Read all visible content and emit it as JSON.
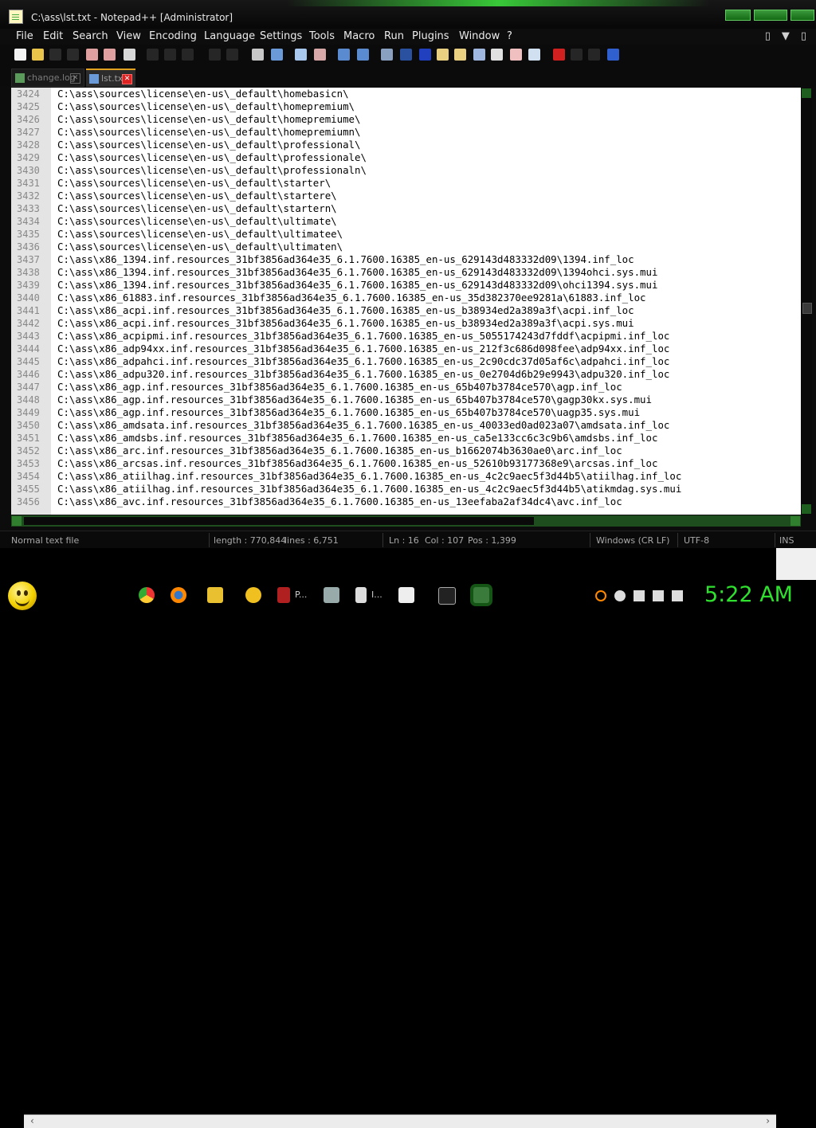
{
  "window": {
    "title": "C:\\ass\\lst.txt - Notepad++ [Administrator]"
  },
  "menu": [
    "File",
    "Edit",
    "Search",
    "View",
    "Encoding",
    "Language",
    "Settings",
    "Tools",
    "Macro",
    "Run",
    "Plugins",
    "Window",
    "?"
  ],
  "menu_right": {
    "restore_glyph": "▯",
    "dropdown_glyph": "▼",
    "close_glyph": "▯"
  },
  "tabs": [
    {
      "label": "change.log",
      "close": "✕"
    },
    {
      "label": "lst.txt",
      "close": "✕"
    }
  ],
  "editor": {
    "lines": [
      {
        "n": "3424",
        "t": "C:\\ass\\sources\\license\\en-us\\_default\\homebasicn\\"
      },
      {
        "n": "3425",
        "t": "C:\\ass\\sources\\license\\en-us\\_default\\homepremium\\"
      },
      {
        "n": "3426",
        "t": "C:\\ass\\sources\\license\\en-us\\_default\\homepremiume\\"
      },
      {
        "n": "3427",
        "t": "C:\\ass\\sources\\license\\en-us\\_default\\homepremiumn\\"
      },
      {
        "n": "3428",
        "t": "C:\\ass\\sources\\license\\en-us\\_default\\professional\\"
      },
      {
        "n": "3429",
        "t": "C:\\ass\\sources\\license\\en-us\\_default\\professionale\\"
      },
      {
        "n": "3430",
        "t": "C:\\ass\\sources\\license\\en-us\\_default\\professionaln\\"
      },
      {
        "n": "3431",
        "t": "C:\\ass\\sources\\license\\en-us\\_default\\starter\\"
      },
      {
        "n": "3432",
        "t": "C:\\ass\\sources\\license\\en-us\\_default\\startere\\"
      },
      {
        "n": "3433",
        "t": "C:\\ass\\sources\\license\\en-us\\_default\\startern\\"
      },
      {
        "n": "3434",
        "t": "C:\\ass\\sources\\license\\en-us\\_default\\ultimate\\"
      },
      {
        "n": "3435",
        "t": "C:\\ass\\sources\\license\\en-us\\_default\\ultimatee\\"
      },
      {
        "n": "3436",
        "t": "C:\\ass\\sources\\license\\en-us\\_default\\ultimaten\\"
      },
      {
        "n": "3437",
        "t": "C:\\ass\\x86_1394.inf.resources_31bf3856ad364e35_6.1.7600.16385_en-us_629143d483332d09\\1394.inf_loc"
      },
      {
        "n": "3438",
        "t": "C:\\ass\\x86_1394.inf.resources_31bf3856ad364e35_6.1.7600.16385_en-us_629143d483332d09\\1394ohci.sys.mui"
      },
      {
        "n": "3439",
        "t": "C:\\ass\\x86_1394.inf.resources_31bf3856ad364e35_6.1.7600.16385_en-us_629143d483332d09\\ohci1394.sys.mui"
      },
      {
        "n": "3440",
        "t": "C:\\ass\\x86_61883.inf.resources_31bf3856ad364e35_6.1.7600.16385_en-us_35d382370ee9281a\\61883.inf_loc"
      },
      {
        "n": "3441",
        "t": "C:\\ass\\x86_acpi.inf.resources_31bf3856ad364e35_6.1.7600.16385_en-us_b38934ed2a389a3f\\acpi.inf_loc"
      },
      {
        "n": "3442",
        "t": "C:\\ass\\x86_acpi.inf.resources_31bf3856ad364e35_6.1.7600.16385_en-us_b38934ed2a389a3f\\acpi.sys.mui"
      },
      {
        "n": "3443",
        "t": "C:\\ass\\x86_acpipmi.inf.resources_31bf3856ad364e35_6.1.7600.16385_en-us_5055174243d7fddf\\acpipmi.inf_loc"
      },
      {
        "n": "3444",
        "t": "C:\\ass\\x86_adp94xx.inf.resources_31bf3856ad364e35_6.1.7600.16385_en-us_212f3c686d098fee\\adp94xx.inf_loc"
      },
      {
        "n": "3445",
        "t": "C:\\ass\\x86_adpahci.inf.resources_31bf3856ad364e35_6.1.7600.16385_en-us_2c90cdc37d05af6c\\adpahci.inf_loc"
      },
      {
        "n": "3446",
        "t": "C:\\ass\\x86_adpu320.inf.resources_31bf3856ad364e35_6.1.7600.16385_en-us_0e2704d6b29e9943\\adpu320.inf_loc"
      },
      {
        "n": "3447",
        "t": "C:\\ass\\x86_agp.inf.resources_31bf3856ad364e35_6.1.7600.16385_en-us_65b407b3784ce570\\agp.inf_loc"
      },
      {
        "n": "3448",
        "t": "C:\\ass\\x86_agp.inf.resources_31bf3856ad364e35_6.1.7600.16385_en-us_65b407b3784ce570\\gagp30kx.sys.mui"
      },
      {
        "n": "3449",
        "t": "C:\\ass\\x86_agp.inf.resources_31bf3856ad364e35_6.1.7600.16385_en-us_65b407b3784ce570\\uagp35.sys.mui"
      },
      {
        "n": "3450",
        "t": "C:\\ass\\x86_amdsata.inf.resources_31bf3856ad364e35_6.1.7600.16385_en-us_40033ed0ad023a07\\amdsata.inf_loc"
      },
      {
        "n": "3451",
        "t": "C:\\ass\\x86_amdsbs.inf.resources_31bf3856ad364e35_6.1.7600.16385_en-us_ca5e133cc6c3c9b6\\amdsbs.inf_loc"
      },
      {
        "n": "3452",
        "t": "C:\\ass\\x86_arc.inf.resources_31bf3856ad364e35_6.1.7600.16385_en-us_b1662074b3630ae0\\arc.inf_loc"
      },
      {
        "n": "3453",
        "t": "C:\\ass\\x86_arcsas.inf.resources_31bf3856ad364e35_6.1.7600.16385_en-us_52610b93177368e9\\arcsas.inf_loc"
      },
      {
        "n": "3454",
        "t": "C:\\ass\\x86_atiilhag.inf.resources_31bf3856ad364e35_6.1.7600.16385_en-us_4c2c9aec5f3d44b5\\atiilhag.inf_loc"
      },
      {
        "n": "3455",
        "t": "C:\\ass\\x86_atiilhag.inf.resources_31bf3856ad364e35_6.1.7600.16385_en-us_4c2c9aec5f3d44b5\\atikmdag.sys.mui"
      },
      {
        "n": "3456",
        "t": "C:\\ass\\x86_avc.inf.resources_31bf3856ad364e35_6.1.7600.16385_en-us_13eefaba2af34dc4\\avc.inf_loc"
      }
    ]
  },
  "status": {
    "type": "Normal text file",
    "length": "length : 770,844",
    "lines": "lines : 6,751",
    "ln": "Ln : 16",
    "col": "Col : 107",
    "pos": "Pos : 1,399",
    "eol": "Windows (CR LF)",
    "encoding": "UTF-8",
    "mode": "INS"
  },
  "taskbar": {
    "items": [
      {
        "label": "P..."
      },
      {
        "label": "I..."
      }
    ],
    "clock": "5:22 AM"
  },
  "colors": {
    "accent": "#2fe02f",
    "editor_bg": "#ffffff",
    "gutter_bg": "#e4e4e4"
  }
}
